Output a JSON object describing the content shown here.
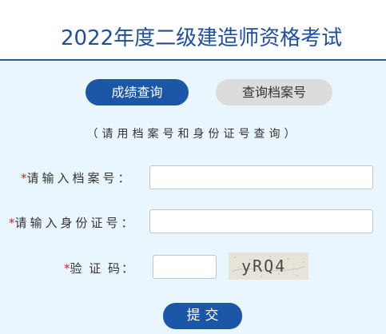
{
  "header": {
    "title": "2022年度二级建造师资格考试"
  },
  "tabs": [
    {
      "label": "成绩查询",
      "active": true
    },
    {
      "label": "查询档案号",
      "active": false
    }
  ],
  "hint": "（请用档案号和身份证号查询）",
  "form": {
    "required_mark": "*",
    "archive_label": "请输入档案号：",
    "archive_value": "",
    "id_label": "请输入身份证号：",
    "id_value": "",
    "captcha_label": "验 证 码：",
    "captcha_value": "",
    "captcha_image_text": "yRQ4"
  },
  "submit_label": "提交",
  "colors": {
    "brand_blue": "#1c56a6",
    "panel_bg": "#eaf6fe",
    "required_red": "#d22222"
  }
}
